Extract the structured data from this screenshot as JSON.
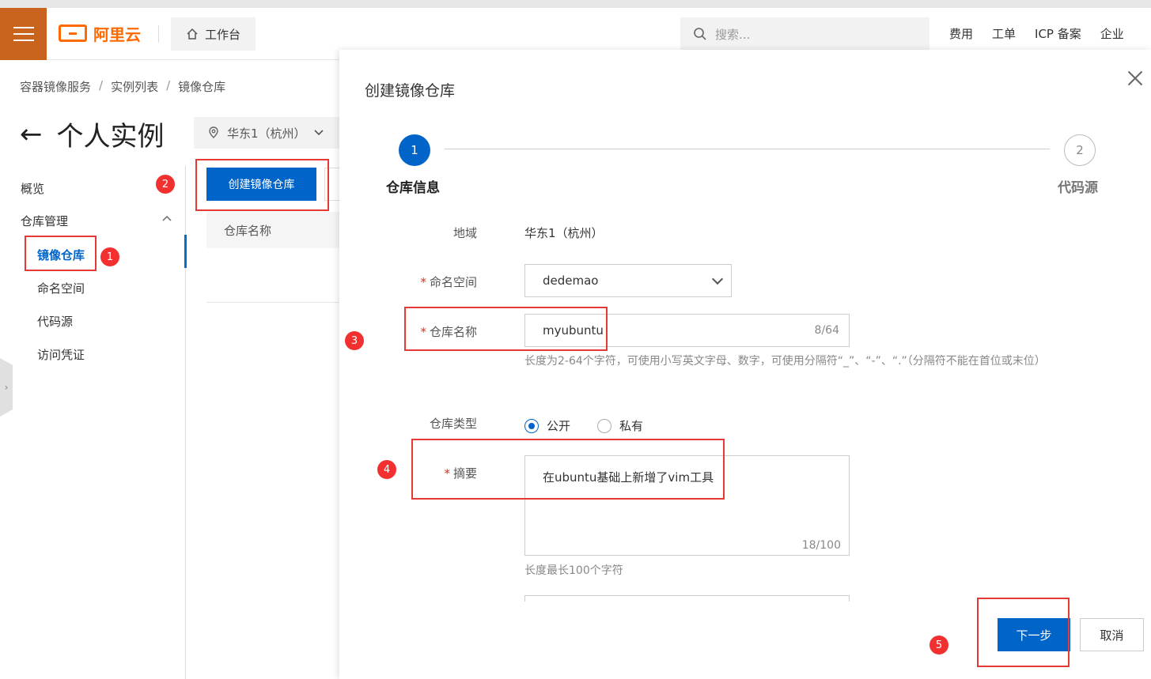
{
  "topbar": {
    "brand": "阿里云",
    "workbench": "工作台",
    "search_placeholder": "搜索...",
    "links": [
      "费用",
      "工单",
      "ICP 备案",
      "企业"
    ]
  },
  "breadcrumb": [
    "容器镜像服务",
    "实例列表",
    "镜像仓库"
  ],
  "page": {
    "back_arrow": "←",
    "title": "个人实例",
    "region": "华东1（杭州）"
  },
  "sidebar": {
    "overview": "概览",
    "repo_mgmt": "仓库管理",
    "items": [
      "镜像仓库",
      "命名空间",
      "代码源",
      "访问凭证"
    ]
  },
  "main": {
    "create_button": "创建镜像仓库",
    "column_repo_name": "仓库名称"
  },
  "dialog": {
    "title": "创建镜像仓库",
    "steps": [
      {
        "num": "1",
        "label": "仓库信息"
      },
      {
        "num": "2",
        "label": "代码源"
      }
    ],
    "region_label": "地域",
    "region_value": "华东1（杭州）",
    "namespace_label": "命名空间",
    "namespace_value": "dedemao",
    "repo_name_label": "仓库名称",
    "repo_name_value": "myubuntu",
    "repo_name_count": "8/64",
    "repo_name_hint": "长度为2-64个字符，可使用小写英文字母、数字，可使用分隔符“_”、“-”、“.”（分隔符不能在首位或末位）",
    "repo_type_label": "仓库类型",
    "type_public": "公开",
    "type_private": "私有",
    "summary_label": "摘要",
    "summary_value": "在ubuntu基础上新增了vim工具",
    "summary_count": "18/100",
    "summary_hint": "长度最长100个字符",
    "next_button": "下一步",
    "cancel_button": "取消"
  },
  "annotations": [
    "1",
    "2",
    "3",
    "4",
    "5"
  ],
  "colors": {
    "brand_orange": "#ff6a00",
    "primary_blue": "#0064c8",
    "annotation_red": "#e53935"
  }
}
